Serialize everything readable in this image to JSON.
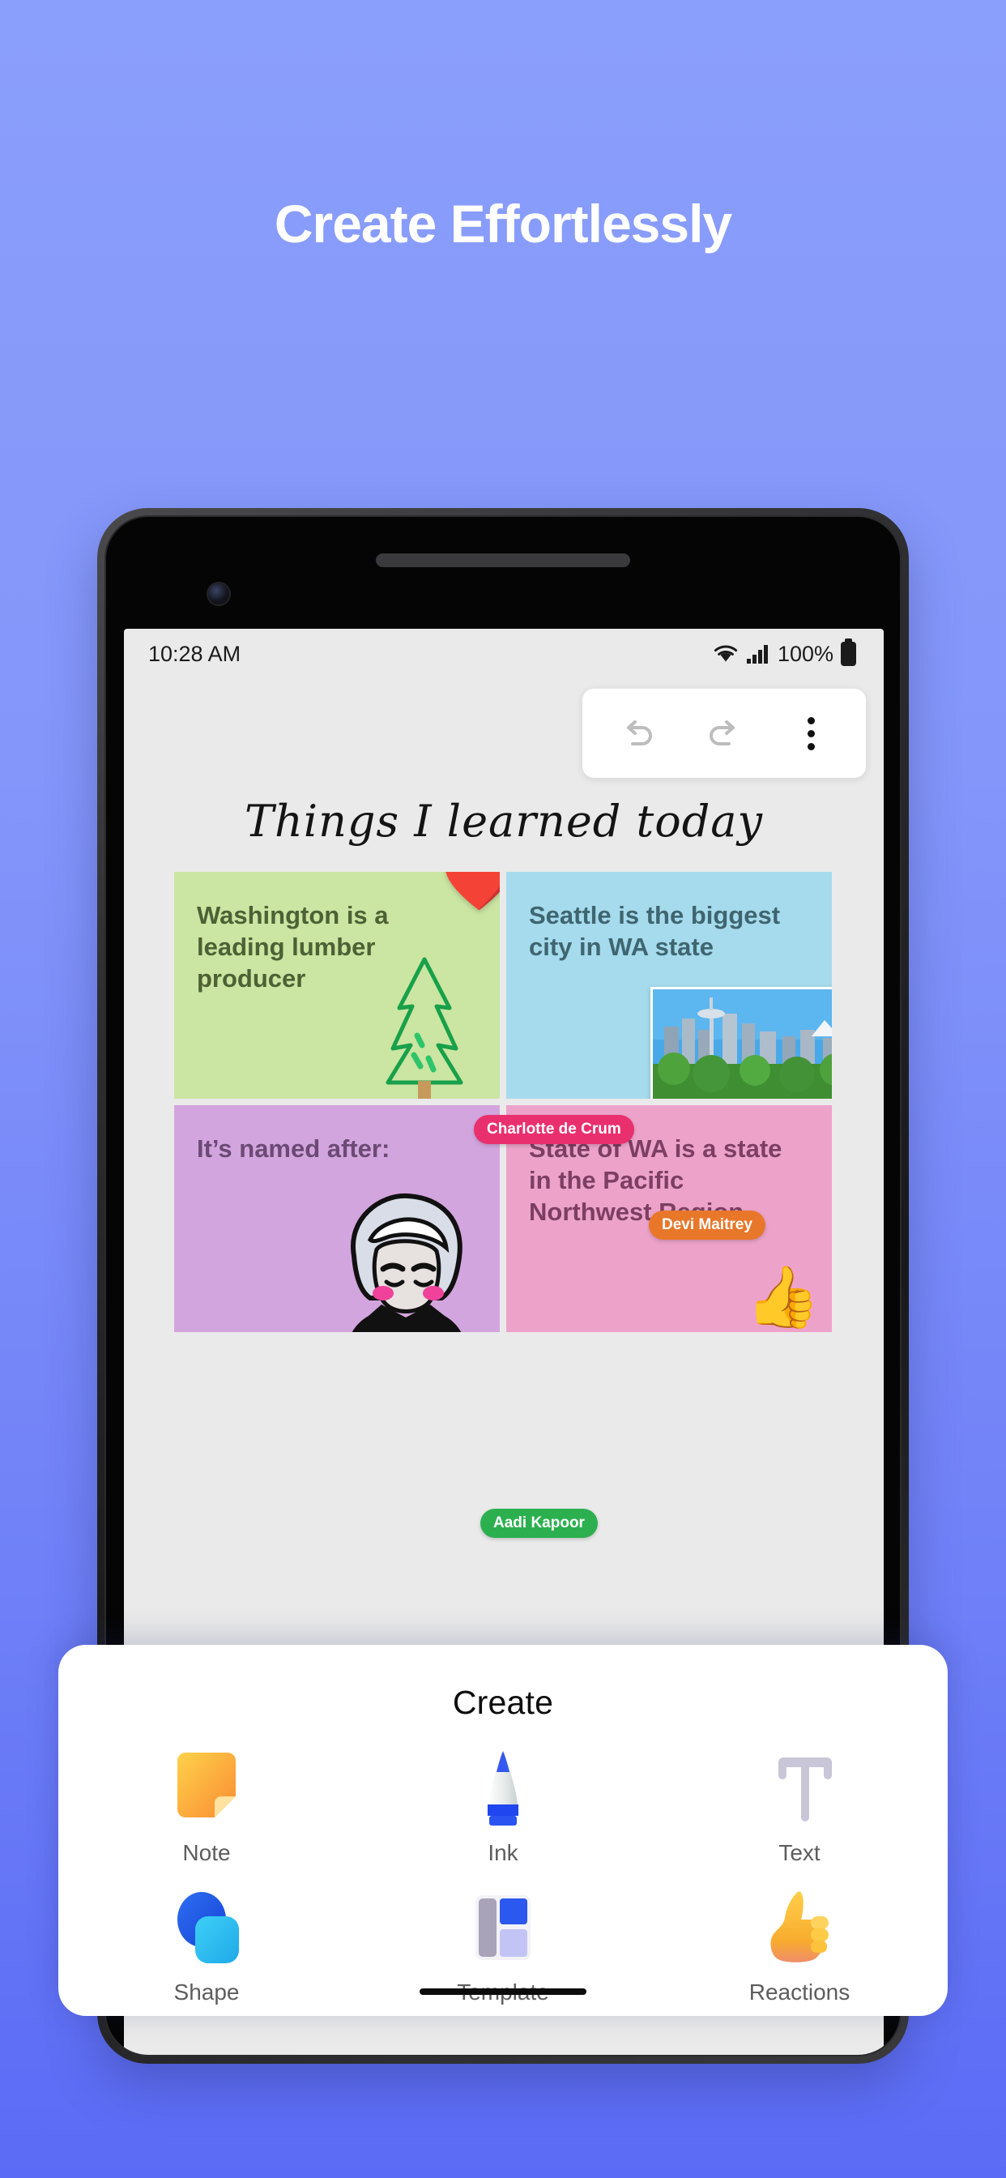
{
  "hero": {
    "title": "Create Effortlessly",
    "background_color": "#8496fa"
  },
  "phone": {
    "status_bar": {
      "time": "10:28 AM",
      "battery": "100%",
      "icons": [
        "wifi-icon",
        "cellular-signal-icon",
        "battery-icon"
      ]
    },
    "toolbar": {
      "undo": "undo-icon",
      "redo": "redo-icon",
      "more": "more-options-icon"
    },
    "board": {
      "title": "Things I learned today",
      "notes": [
        {
          "text": "Washington is a leading lumber producer",
          "color": "#cbe5a2",
          "name": "note-lumber"
        },
        {
          "text": "Seattle is the biggest city in WA state",
          "color": "#a5dbec",
          "name": "note-seattle"
        },
        {
          "text": "It’s named after:",
          "color": "#d3a5de",
          "name": "note-named-after"
        },
        {
          "text": "State of WA is a state in the Pacific Northwest Region",
          "color": "#eda3c9",
          "name": "note-pacific-northwest"
        }
      ],
      "collaborators": [
        {
          "name": "Charlotte de Crum",
          "color": "#ea2f6e"
        },
        {
          "name": "Devi Maitrey",
          "color": "#e8772a"
        },
        {
          "name": "Aadi Kapoor",
          "color": "#2cb04f"
        }
      ]
    }
  },
  "sheet": {
    "title": "Create",
    "items": [
      {
        "label": "Note",
        "icon": "sticky-note-icon"
      },
      {
        "label": "Ink",
        "icon": "pen-icon"
      },
      {
        "label": "Text",
        "icon": "text-t-icon"
      },
      {
        "label": "Shape",
        "icon": "shapes-icon"
      },
      {
        "label": "Template",
        "icon": "template-icon"
      },
      {
        "label": "Reactions",
        "icon": "thumbs-up-icon"
      }
    ]
  }
}
